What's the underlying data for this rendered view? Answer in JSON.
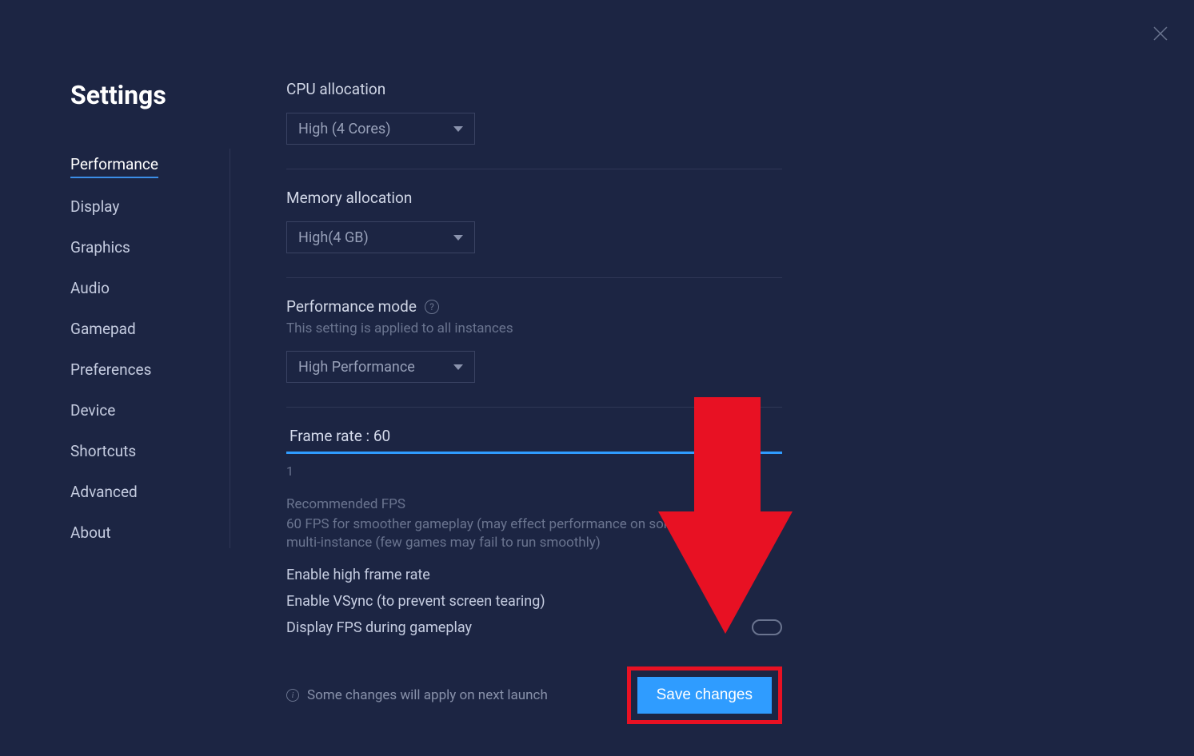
{
  "title": "Settings",
  "sidebar": {
    "items": [
      {
        "label": "Performance",
        "active": true
      },
      {
        "label": "Display"
      },
      {
        "label": "Graphics"
      },
      {
        "label": "Audio"
      },
      {
        "label": "Gamepad"
      },
      {
        "label": "Preferences"
      },
      {
        "label": "Device"
      },
      {
        "label": "Shortcuts"
      },
      {
        "label": "Advanced"
      },
      {
        "label": "About"
      }
    ]
  },
  "cpu": {
    "label": "CPU allocation",
    "value": "High (4 Cores)"
  },
  "memory": {
    "label": "Memory allocation",
    "value": "High(4 GB)"
  },
  "perfmode": {
    "label": "Performance mode",
    "sublabel": "This setting is applied to all instances",
    "value": "High Performance"
  },
  "framerate": {
    "label": "Frame rate : 60",
    "tick_min": "1",
    "rec_title": "Recommended FPS",
    "rec_body": "60 FPS for smoother gameplay (may effect performance on some entry level PC's multi-instance (few games may fail to run smoothly)"
  },
  "toggles": {
    "high_frame": "Enable high frame rate",
    "vsync": "Enable VSync (to prevent screen tearing)",
    "display_fps": "Display FPS during gameplay"
  },
  "footer": {
    "note": "Some changes will apply on next launch",
    "save": "Save changes"
  }
}
